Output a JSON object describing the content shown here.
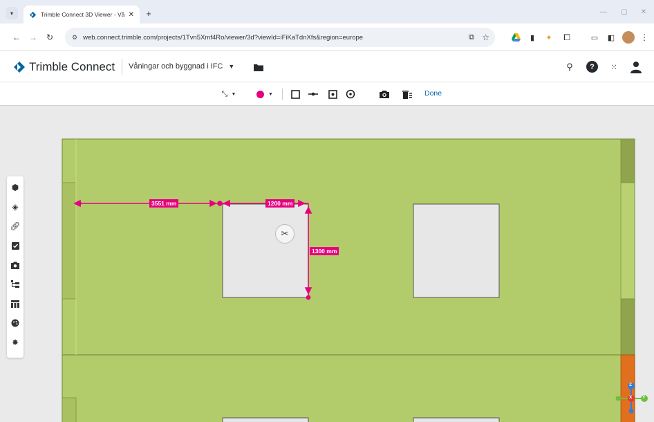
{
  "browser": {
    "tab_title": "Trimble Connect 3D Viewer - Vå",
    "new_tab": "+",
    "url": "web.connect.trimble.com/projects/1Tvn5Xmf4Ro/viewer/3d?viewId=iFiKaTdnXfs&region=europe"
  },
  "app": {
    "brand": "Trimble Connect",
    "project_name": "Våningar och byggnad i IFC"
  },
  "toolbar": {
    "done_label": "Done",
    "accent": "#e6007e"
  },
  "measurements": {
    "horizontal_left": "3551 mm",
    "horizontal_right": "1200 mm",
    "vertical": "1300 mm"
  },
  "axis_gizmo": {
    "z": "Z",
    "x": "X",
    "y": "Y"
  },
  "sidebar_icons": [
    "cube-icon",
    "layers-icon",
    "link-icon",
    "checklist-icon",
    "camera-icon",
    "tree-icon",
    "table-icon",
    "paint-icon",
    "settings-icon"
  ],
  "colors": {
    "wall": "#b3cc6b",
    "opening": "#e7e7e7",
    "dimension": "#e6007e"
  }
}
